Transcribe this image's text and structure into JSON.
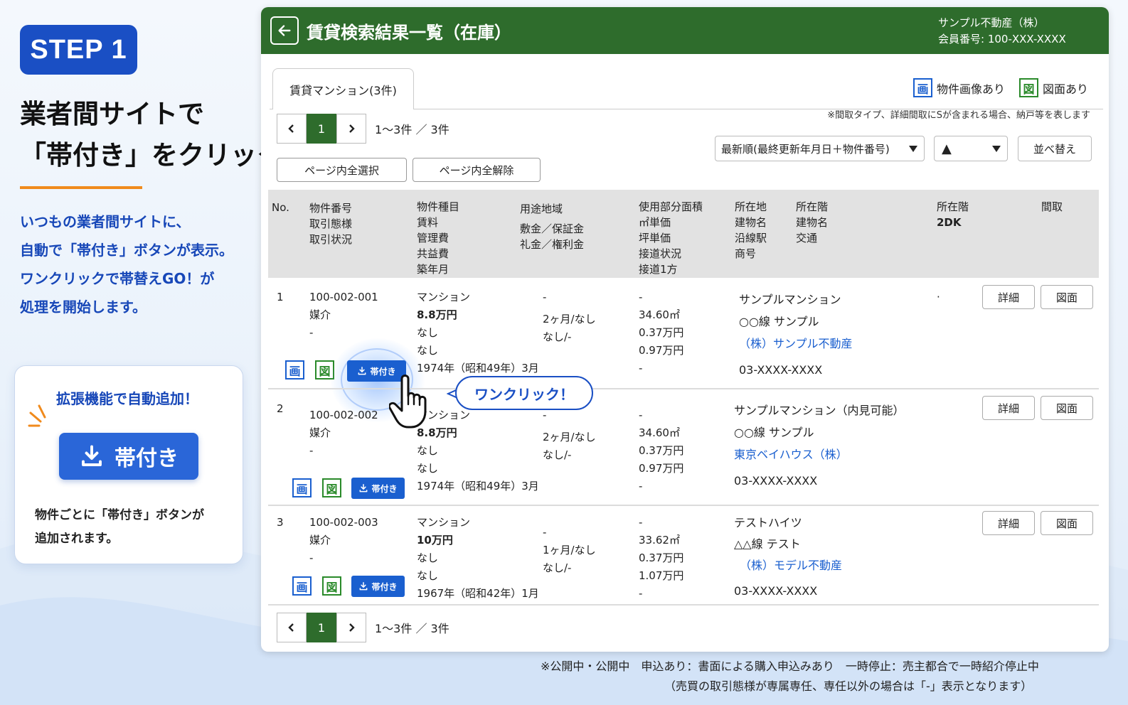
{
  "promo": {
    "step_label": "STEP 1",
    "headline_line1": "業者間サイトで",
    "headline_line2": "「帯付き」をクリック",
    "desc_lines": [
      "いつもの業者間サイトに、",
      "自動で「帯付き」ボタンが表示。",
      "ワンクリックで帯替えGO！が",
      "処理を開始します。"
    ],
    "ext_title": "拡張機能で自動追加！",
    "ext_button_label": "帯付き",
    "ext_desc_line1": "物件ごとに「帯付き」ボタンが",
    "ext_desc_line2": "追加されます。"
  },
  "window": {
    "title": "賃貸検索結果一覧（在庫）",
    "company_name": "サンプル不動産（株）",
    "member_no": "会員番号: 100-XXX-XXXX",
    "tab_label": "賃貸マンション(3件)",
    "legend_image_icon": "画",
    "legend_image_label": "物件画像あり",
    "legend_plan_icon": "図",
    "legend_plan_label": "図面あり",
    "note_top": "※間取タイプ、詳細間取にSが含まれる場合、納戸等を表します",
    "pager": {
      "current_page": "1",
      "count_text": "1〜3件 ／ 3件"
    },
    "sort_select_value": "最新順(最終更新年月日＋物件番号)",
    "order_select_value": "▲",
    "sort_button_label": "並べ替え",
    "select_all_label": "ページ内全選択",
    "deselect_all_label": "ページ内全解除",
    "columns": {
      "no": "No.",
      "c1": [
        "物件番号",
        "取引態様",
        "取引状況"
      ],
      "c2": [
        "物件種目",
        "賃料",
        "管理費",
        "共益費",
        "築年月"
      ],
      "c3": [
        "用途地域",
        "敷金／保証金",
        "礼金／権利金"
      ],
      "c4": [
        "使用部分面積",
        "㎡単価",
        "坪単価",
        "接道状況",
        "接道1方"
      ],
      "c5": [
        "所在地",
        "建物名",
        "沿線駅",
        "商号"
      ],
      "c6": [
        "所在階",
        "建物名",
        "交通"
      ],
      "c7": [
        "所在階",
        "2DK"
      ],
      "c8": "間取"
    },
    "rows": [
      {
        "no": "1",
        "prop_no": "100-002-001",
        "deal_type": "媒介",
        "deal_status": "-",
        "prop_type": "マンション",
        "rent": "8.8万円",
        "mgmt": "なし",
        "common": "なし",
        "built": "1974年（昭和49年）3月",
        "zone": "-",
        "deposit": "2ヶ月/なし",
        "key_money": "なし/-",
        "a1": "-",
        "area": "34.60㎡",
        "sqm_price": "0.37万円",
        "tsubo_price": "0.97万円",
        "a5": "-",
        "building": "サンプルマンション",
        "station": "○○線 サンプル",
        "company": "（株）サンプル不動産",
        "phone": "03-XXXX-XXXX",
        "floor_val": "·"
      },
      {
        "no": "2",
        "prop_no": "100-002-002",
        "deal_type": "媒介",
        "deal_status": "-",
        "prop_type": "マンション",
        "rent": "8.8万円",
        "mgmt": "なし",
        "common": "なし",
        "built": "1974年（昭和49年）3月",
        "zone": "-",
        "deposit": "2ヶ月/なし",
        "key_money": "なし/-",
        "a1": "-",
        "area": "34.60㎡",
        "sqm_price": "0.37万円",
        "tsubo_price": "0.97万円",
        "a5": "-",
        "building": "サンプルマンション（内見可能）",
        "station": "○○線 サンプル",
        "company": "東京ベイハウス（株）",
        "phone": "03-XXXX-XXXX"
      },
      {
        "no": "3",
        "prop_no": "100-002-003",
        "deal_type": "媒介",
        "deal_status": "-",
        "prop_type": "マンション",
        "rent": "10万円",
        "mgmt": "なし",
        "common": "なし",
        "built": "1967年（昭和42年）1月",
        "zone": "-",
        "deposit": "1ヶ月/なし",
        "key_money": "なし/-",
        "a1": "-",
        "area": "33.62㎡",
        "sqm_price": "0.37万円",
        "tsubo_price": "1.07万円",
        "a5": "-",
        "building": "テストハイツ",
        "station": "△△線 テスト",
        "company": "（株）モデル不動産",
        "phone": "03-XXXX-XXXX"
      }
    ],
    "detail_label": "詳細",
    "plan_label": "図面",
    "row_image_icon": "画",
    "row_plan_icon": "図",
    "obi_label": "帯付き",
    "callout": "ワンクリック！"
  },
  "footer": {
    "line1": "※公開中・公開中　申込あり：書面による購入申込みあり　一時停止：売主都合で一時紹介停止中",
    "line2": "（売買の取引態様が専属専任、専任以外の場合は「-」表示となります）"
  },
  "colors": {
    "header_green": "#2e6c2c",
    "brand_blue": "#1a4fc4",
    "accent_orange": "#f08a1c",
    "link_blue": "#1a5fcf"
  }
}
